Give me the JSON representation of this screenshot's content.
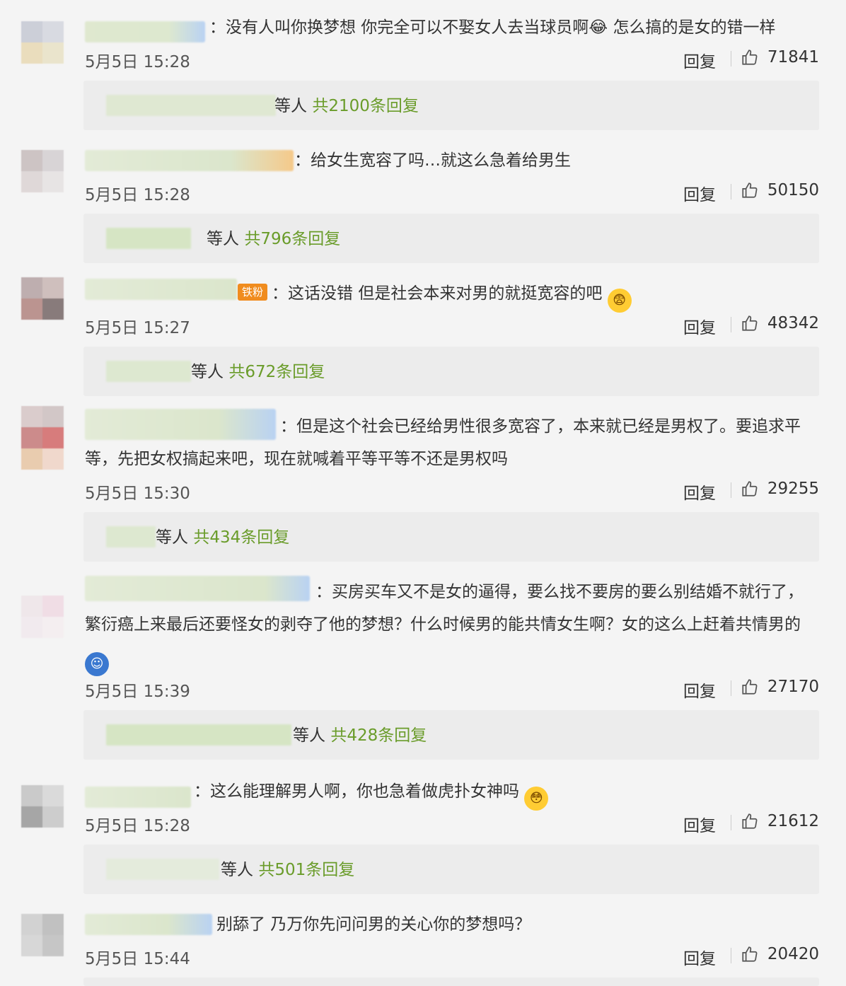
{
  "comments": [
    {
      "text": "：没有人叫你换梦想 你完全可以不娶女人去当球员啊😂 怎么搞的是女的错一样",
      "date": "5月5日 15:28",
      "reply_label": "回复",
      "likes": "71841",
      "reply_summary": {
        "prefix": "等人",
        "count": "共2100条回复"
      }
    },
    {
      "text": "：给女生宽容了吗…就这么急着给男生",
      "date": "5月5日 15:28",
      "reply_label": "回复",
      "likes": "50150",
      "reply_summary": {
        "prefix": "等人",
        "count": "共796条回复"
      }
    },
    {
      "badge": "铁粉",
      "text": "：这话没错 但是社会本来对男的就挺宽容的吧",
      "date": "5月5日 15:27",
      "reply_label": "回复",
      "likes": "48342",
      "reply_summary": {
        "prefix": "等人",
        "count": "共672条回复"
      }
    },
    {
      "text": "：但是这个社会已经给男性很多宽容了，本来就已经是男权了。要追求平等，先把女权搞起来吧，现在就喊着平等平等不还是男权吗",
      "date": "5月5日 15:30",
      "reply_label": "回复",
      "likes": "29255",
      "reply_summary": {
        "prefix": "等人",
        "count": "共434条回复"
      }
    },
    {
      "text": "：买房买车又不是女的逼得，要么找不要房的要么别结婚不就行了，繁衍癌上来最后还要怪女的剥夺了他的梦想？什么时候男的能共情女生啊？女的这么上赶着共情男的",
      "date": "5月5日 15:39",
      "reply_label": "回复",
      "likes": "27170",
      "reply_summary": {
        "prefix": "等人",
        "count": "共428条回复"
      }
    },
    {
      "text": "：这么能理解男人啊，你也急着做虎扑女神吗",
      "date": "5月5日 15:28",
      "reply_label": "回复",
      "likes": "21612",
      "reply_summary": {
        "prefix": "等人",
        "count": "共501条回复"
      }
    },
    {
      "text": "别舔了 乃万你先问问男的关心你的梦想吗？",
      "date": "5月5日 15:44",
      "reply_label": "回复",
      "likes": "20420"
    }
  ],
  "colors": {
    "reply_count": "#6a9c2a",
    "name_blur": "#d9e6c8",
    "background": "#f4f4f4"
  },
  "icons": {
    "like": "thumbs-up-icon",
    "emoji": "emoji-icon"
  }
}
